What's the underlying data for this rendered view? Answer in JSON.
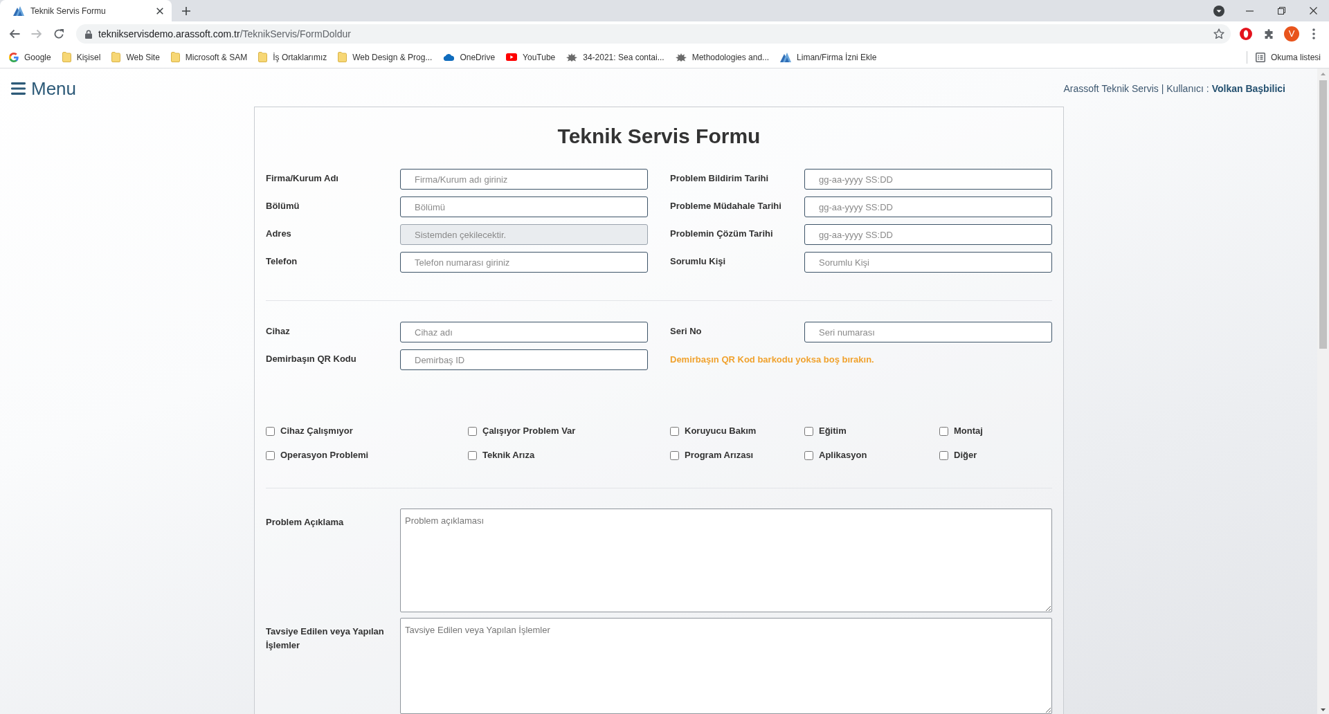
{
  "browser": {
    "tab": {
      "title": "Teknik Servis Formu"
    },
    "nav": {
      "back_disabled": false,
      "forward_disabled": true
    },
    "url": {
      "host": "teknikservisdemo.arassoft.com.tr",
      "path": "/TeknikServis/FormDoldur"
    },
    "profile_initial": "V",
    "bookmarks": [
      {
        "label": "Google",
        "kind": "google"
      },
      {
        "label": "Kişisel",
        "kind": "folder"
      },
      {
        "label": "Web Site",
        "kind": "folder"
      },
      {
        "label": "Microsoft & SAM",
        "kind": "folder"
      },
      {
        "label": "İş Ortaklarımız",
        "kind": "folder"
      },
      {
        "label": "Web Design & Prog...",
        "kind": "folder"
      },
      {
        "label": "OneDrive",
        "kind": "cloud"
      },
      {
        "label": "YouTube",
        "kind": "video"
      },
      {
        "label": "34-2021: Sea contai...",
        "kind": "emblem"
      },
      {
        "label": "Methodologies and...",
        "kind": "emblem"
      },
      {
        "label": "Liman/Firma İzni Ekle",
        "kind": "triangles"
      }
    ],
    "reading_list": "Okuma listesi"
  },
  "page": {
    "menu_label": "Menu",
    "user_info": "Arassoft Teknik Servis | Kullanıcı : **Volkan Başbilici**"
  },
  "form": {
    "title": "Teknik Servis Formu",
    "general_rows": [
      [
        {
          "kind": "input",
          "label": "Firma/Kurum Adı",
          "placeholder": "Firma/Kurum adı giriniz",
          "disabled": false
        },
        {
          "kind": "input",
          "label": "Problem Bildirim Tarihi",
          "placeholder": "gg-aa-yyyy SS:DD",
          "disabled": false
        }
      ],
      [
        {
          "kind": "input",
          "label": "Bölümü",
          "placeholder": "Bölümü",
          "disabled": false
        },
        {
          "kind": "input",
          "label": "Probleme Müdahale Tarihi",
          "placeholder": "gg-aa-yyyy SS:DD",
          "disabled": false
        }
      ],
      [
        {
          "kind": "input",
          "label": "Adres",
          "placeholder": "Sistemden çekilecektir.",
          "disabled": true
        },
        {
          "kind": "input",
          "label": "Problemin Çözüm Tarihi",
          "placeholder": "gg-aa-yyyy SS:DD",
          "disabled": false
        }
      ],
      [
        {
          "kind": "input",
          "label": "Telefon",
          "placeholder": "Telefon numarası giriniz",
          "disabled": false
        },
        {
          "kind": "input",
          "label": "Sorumlu Kişi",
          "placeholder": "Sorumlu Kişi",
          "disabled": false
        }
      ]
    ],
    "device_rows": [
      [
        {
          "kind": "input",
          "label": "Cihaz",
          "placeholder": "Cihaz adı",
          "disabled": false
        },
        {
          "kind": "input",
          "label": "Seri No",
          "placeholder": "Seri numarası",
          "disabled": false
        }
      ],
      [
        {
          "kind": "input",
          "label": "Demirbaşın QR Kodu",
          "placeholder": "Demirbaş ID",
          "disabled": false
        },
        {
          "kind": "note",
          "text": "Demirbaşın QR Kod barkodu yoksa boş bırakın."
        }
      ]
    ],
    "issue_types": [
      {
        "label": "Cihaz Çalışmıyor",
        "checked": false
      },
      {
        "label": "Çalışıyor Problem Var",
        "checked": false
      },
      {
        "label": "Koruyucu Bakım",
        "checked": false
      },
      {
        "label": "Eğitim",
        "checked": false
      },
      {
        "label": "Montaj",
        "checked": false
      },
      {
        "label": "Operasyon Problemi",
        "checked": false
      },
      {
        "label": "Teknik Arıza",
        "checked": false
      },
      {
        "label": "Program Arızası",
        "checked": false
      },
      {
        "label": "Aplikasyon",
        "checked": false
      },
      {
        "label": "Diğer",
        "checked": false
      }
    ],
    "text_areas": [
      {
        "label": "Problem Açıklama",
        "placeholder": "Problem açıklaması"
      },
      {
        "label": "Tavsiye Edilen veya Yapılan İşlemler",
        "placeholder": "Tavsiye Edilen veya Yapılan İşlemler"
      }
    ]
  }
}
